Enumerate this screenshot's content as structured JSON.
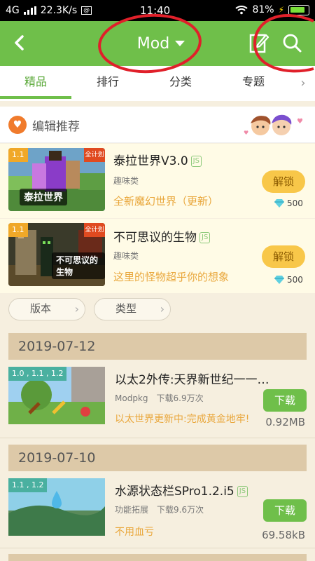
{
  "status": {
    "network": "4G",
    "speed": "22.3K/s",
    "time": "11:40",
    "battery": "81%"
  },
  "header": {
    "title": "Mod"
  },
  "tabs": [
    {
      "label": "精品",
      "active": true
    },
    {
      "label": "排行",
      "active": false
    },
    {
      "label": "分类",
      "active": false
    },
    {
      "label": "专题",
      "active": false
    }
  ],
  "section": {
    "title": "编辑推荐"
  },
  "featured": [
    {
      "version": "1.1",
      "corner": "全计划",
      "thumb_caption": "泰拉世界",
      "title": "泰拉世界V3.0",
      "badge": "JS",
      "category": "趣味类",
      "description": "全新魔幻世界（更新）",
      "action": "解锁",
      "price": "500"
    },
    {
      "version": "1.1",
      "corner": "全计划",
      "thumb_caption": "不可思议的生物",
      "title": "不可思议的生物",
      "badge": "JS",
      "category": "趣味类",
      "description": "这里的怪物超乎你的想象",
      "action": "解锁",
      "price": "500"
    }
  ],
  "filters": [
    {
      "label": "版本"
    },
    {
      "label": "类型"
    }
  ],
  "groups": [
    {
      "date": "2019-07-12",
      "items": [
        {
          "versions": "1.0 , 1.1 , 1.2",
          "title": "以太2外传:天界新世纪一一…",
          "category": "Modpkg",
          "downloads": "下载6.9万次",
          "description": "以太世界更新中:完成黄金地牢!",
          "action": "下载",
          "size": "0.92MB"
        }
      ]
    },
    {
      "date": "2019-07-10",
      "items": [
        {
          "versions": "1.1 , 1.2",
          "title": "水源状态栏SPro1.2.i5",
          "badge": "JS",
          "category": "功能拓展",
          "downloads": "下载9.6万次",
          "description": "不用血亏",
          "action": "下载",
          "size": "69.58kB"
        }
      ]
    }
  ],
  "colors": {
    "primary": "#6fbf4a",
    "accent_orange": "#e9a73c",
    "unlock": "#f8c749",
    "date_bar": "#ddc9a8",
    "annotation_red": "#e0202a"
  }
}
